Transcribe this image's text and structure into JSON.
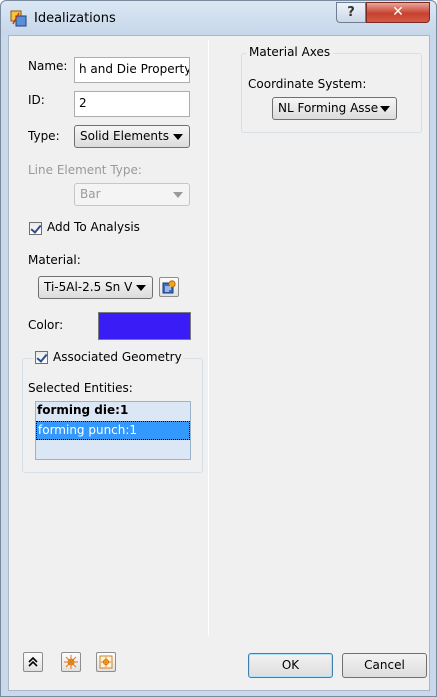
{
  "window": {
    "title": "Idealizations",
    "help_label": "?",
    "close_label": "✕"
  },
  "form": {
    "name_label": "Name:",
    "name_value": "h and Die Property",
    "id_label": "ID:",
    "id_value": "2",
    "type_label": "Type:",
    "type_value": "Solid Elements",
    "line_element_type_label": "Line Element Type:",
    "line_element_type_value": "Bar",
    "add_to_analysis_label": "Add To Analysis",
    "add_to_analysis_checked": true,
    "material_label": "Material:",
    "material_value": "Ti-5Al-2.5 Sn V",
    "color_label": "Color:",
    "color_value": "#3a1cf6"
  },
  "associated_geometry": {
    "title": "Associated Geometry",
    "checked": true,
    "selected_entities_label": "Selected Entities:",
    "entities": [
      {
        "label": "forming die:1",
        "bold": true,
        "selected": false
      },
      {
        "label": "forming punch:1",
        "bold": false,
        "selected": true
      }
    ]
  },
  "material_axes": {
    "title": "Material Axes",
    "coordinate_system_label": "Coordinate System:",
    "coordinate_system_value": "NL Forming Asse"
  },
  "footer": {
    "icons": [
      "collapse-icon",
      "sparkle-icon",
      "sparkle-multi-icon"
    ],
    "ok_label": "OK",
    "cancel_label": "Cancel"
  },
  "colors": {
    "selection": "#3399ff",
    "list_background": "#dce7f5",
    "titlebar": "#c6d7ea"
  }
}
